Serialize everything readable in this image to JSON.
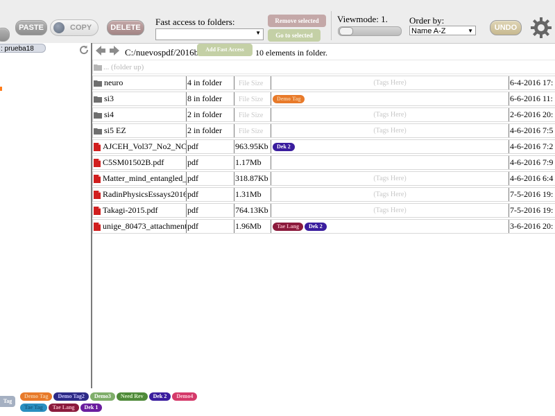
{
  "toolbar": {
    "paste_label": "PASTE",
    "copy_label": "COPY",
    "delete_label": "DELETE",
    "fast_access_label": "Fast access to folders:",
    "fast_access_value": "",
    "remove_selected_label": "Remove selected",
    "go_to_selected_label": "Go to selected",
    "viewmode_label": "Viewmode: 1.",
    "viewmode_level": 1,
    "order_by_label": "Order by:",
    "order_by_value": "Name A-Z",
    "undo_label": "UNDO"
  },
  "sidebar": {
    "tree_item_label": ": prueba18"
  },
  "path_bar": {
    "path": "C:/nuevospdf/2016b",
    "add_fast_access_label": "Add Fast Access",
    "element_count": "10 elements in folder."
  },
  "files": {
    "folder_up_label": "... (folder up)",
    "rows": [
      {
        "name": "neuro",
        "icon": "folder-icon",
        "type": "4 in folder",
        "size": "",
        "size_placeholder": "File Size",
        "tags_placeholder": "(Tags Here)",
        "tags": [],
        "date": "6-4-2016 17:"
      },
      {
        "name": "si3",
        "icon": "folder-icon",
        "type": "8 in folder",
        "size": "",
        "size_placeholder": "File Size",
        "tags_placeholder": "",
        "tags": [
          {
            "label": "Demo Tag",
            "color": "#e87a2a",
            "text": "#f5c79a"
          }
        ],
        "date": "6-6-2016 11:"
      },
      {
        "name": "si4",
        "icon": "folder-icon",
        "type": "2 in folder",
        "size": "",
        "size_placeholder": "File Size",
        "tags_placeholder": "(Tags Here)",
        "tags": [],
        "date": "2-6-2016 20:"
      },
      {
        "name": "si5 EZ",
        "icon": "folder-icon",
        "type": "2 in folder",
        "size": "",
        "size_placeholder": "File Size",
        "tags_placeholder": "(Tags Here)",
        "tags": [],
        "date": "4-6-2016 7:5"
      },
      {
        "name": "AJCEH_Vol37_No2_NC",
        "icon": "pdf-icon",
        "type": "pdf",
        "size": "963.95Kb",
        "size_placeholder": "",
        "tags_placeholder": "",
        "tags": [
          {
            "label": "Dek 2",
            "color": "#3a1d9e",
            "text": "#ffffff"
          }
        ],
        "date": "4-6-2016 7:2"
      },
      {
        "name": "C5SM01502B.pdf",
        "icon": "pdf-icon",
        "type": "pdf",
        "size": "1.17Mb",
        "size_placeholder": "",
        "tags_placeholder": "",
        "tags": [],
        "date": "4-6-2016 7:9"
      },
      {
        "name": "Matter_mind_entangled_",
        "icon": "pdf-icon",
        "type": "pdf",
        "size": "318.87Kb",
        "size_placeholder": "",
        "tags_placeholder": "(Tags Here)",
        "tags": [],
        "date": "4-6-2016 6:4"
      },
      {
        "name": "RadinPhysicsEssays2016",
        "icon": "pdf-icon",
        "type": "pdf",
        "size": "1.31Mb",
        "size_placeholder": "",
        "tags_placeholder": "(Tags Here)",
        "tags": [],
        "date": "7-5-2016 19:"
      },
      {
        "name": "Takagi-2015.pdf",
        "icon": "pdf-icon",
        "type": "pdf",
        "size": "764.13Kb",
        "size_placeholder": "",
        "tags_placeholder": "(Tags Here)",
        "tags": [],
        "date": "7-5-2016 19:"
      },
      {
        "name": "unige_80473_attachment",
        "icon": "pdf-icon",
        "type": "pdf",
        "size": "1.96Mb",
        "size_placeholder": "",
        "tags_placeholder": "",
        "tags": [
          {
            "label": "Tae Lang",
            "color": "#8b1a3c",
            "text": "#f3b0c0"
          },
          {
            "label": "Dek 2",
            "color": "#3a1d9e",
            "text": "#ffffff"
          }
        ],
        "date": "3-6-2016 20:"
      }
    ]
  },
  "bottom": {
    "tag_button_label": "Tag",
    "tag_bank": [
      {
        "label": "Demo Tag",
        "color": "#e87a2a",
        "text": "#f5c79a"
      },
      {
        "label": "Demo Tag2",
        "color": "#2d2a86",
        "text": "#c9c6ff"
      },
      {
        "label": "Demo3",
        "color": "#7fae6a",
        "text": "#ffffff"
      },
      {
        "label": "Need Rev",
        "color": "#4f8a3a",
        "text": "#d9f0c8"
      },
      {
        "label": "Dek 2",
        "color": "#3a1d9e",
        "text": "#ffffff"
      },
      {
        "label": "Demo4",
        "color": "#d43a6a",
        "text": "#ffd0de"
      },
      {
        "label": "Tae Tag",
        "color": "#2a8fc0",
        "text": "#1a5c80"
      },
      {
        "label": "Tae Lang",
        "color": "#8b1a3c",
        "text": "#f3b0c0"
      },
      {
        "label": "Dek 1",
        "color": "#6a1d9e",
        "text": "#ffffff"
      }
    ]
  }
}
